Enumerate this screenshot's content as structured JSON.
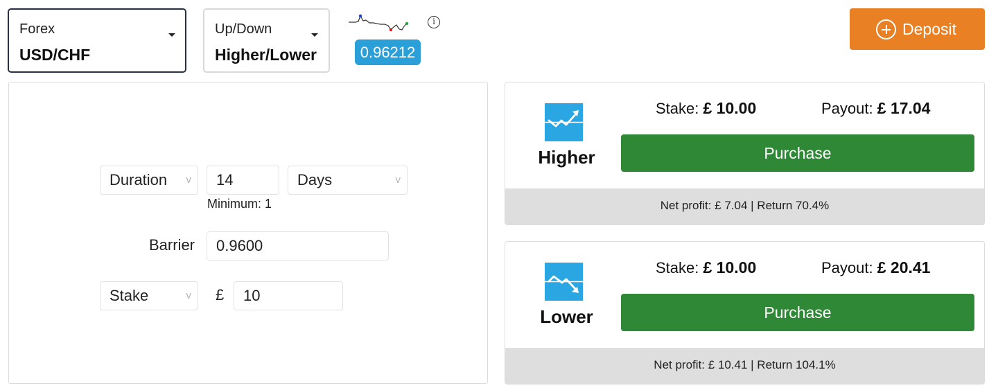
{
  "market": {
    "category": "Forex",
    "selected": "USD/CHF"
  },
  "trade_type": {
    "category": "Up/Down",
    "selected": "Higher/Lower"
  },
  "spot": {
    "price": "0.96212",
    "info_icon": "info-icon"
  },
  "deposit": {
    "label": "Deposit",
    "icon": "plus-circle-icon"
  },
  "form": {
    "duration_select": "Duration",
    "duration_value": "14",
    "duration_unit": "Days",
    "minimum_note": "Minimum: 1",
    "barrier_label": "Barrier",
    "barrier_value": "0.9600",
    "stake_select": "Stake",
    "currency_symbol": "£",
    "stake_value": "10",
    "chevron": "v"
  },
  "contracts": [
    {
      "name": "Higher",
      "icon": "rise-arrow-icon",
      "stake_label": "Stake:",
      "stake_amount": "£ 10.00",
      "payout_label": "Payout:",
      "payout_amount": "£ 17.04",
      "button": "Purchase",
      "footer": "Net profit: £ 7.04 | Return 70.4%"
    },
    {
      "name": "Lower",
      "icon": "fall-arrow-icon",
      "stake_label": "Stake:",
      "stake_amount": "£ 10.00",
      "payout_label": "Payout:",
      "payout_amount": "£ 20.41",
      "button": "Purchase",
      "footer": "Net profit: £ 10.41 | Return 104.1%"
    }
  ],
  "colors": {
    "deposit": "#e98024",
    "purchase": "#2e8836",
    "spot_badge": "#2a9fd8",
    "contract_icon": "#2aa6e3",
    "footer_bg": "#dedede"
  }
}
